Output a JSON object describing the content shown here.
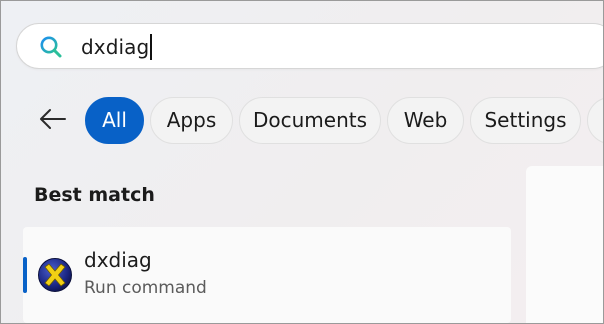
{
  "search": {
    "query": "dxdiag",
    "icon": "search-icon"
  },
  "filters": {
    "back_icon": "back-arrow-icon",
    "tabs": [
      {
        "label": "All",
        "active": true
      },
      {
        "label": "Apps",
        "active": false
      },
      {
        "label": "Documents",
        "active": false
      },
      {
        "label": "Web",
        "active": false
      },
      {
        "label": "Settings",
        "active": false
      },
      {
        "label": "",
        "active": false
      }
    ]
  },
  "results": {
    "section_title": "Best match",
    "best_match": {
      "title": "dxdiag",
      "subtitle": "Run command",
      "icon": "dxdiag-app-icon"
    }
  },
  "colors": {
    "accent": "#0861c7",
    "search_icon_gradient": [
      "#1c8ef0",
      "#2bbf9a"
    ]
  }
}
